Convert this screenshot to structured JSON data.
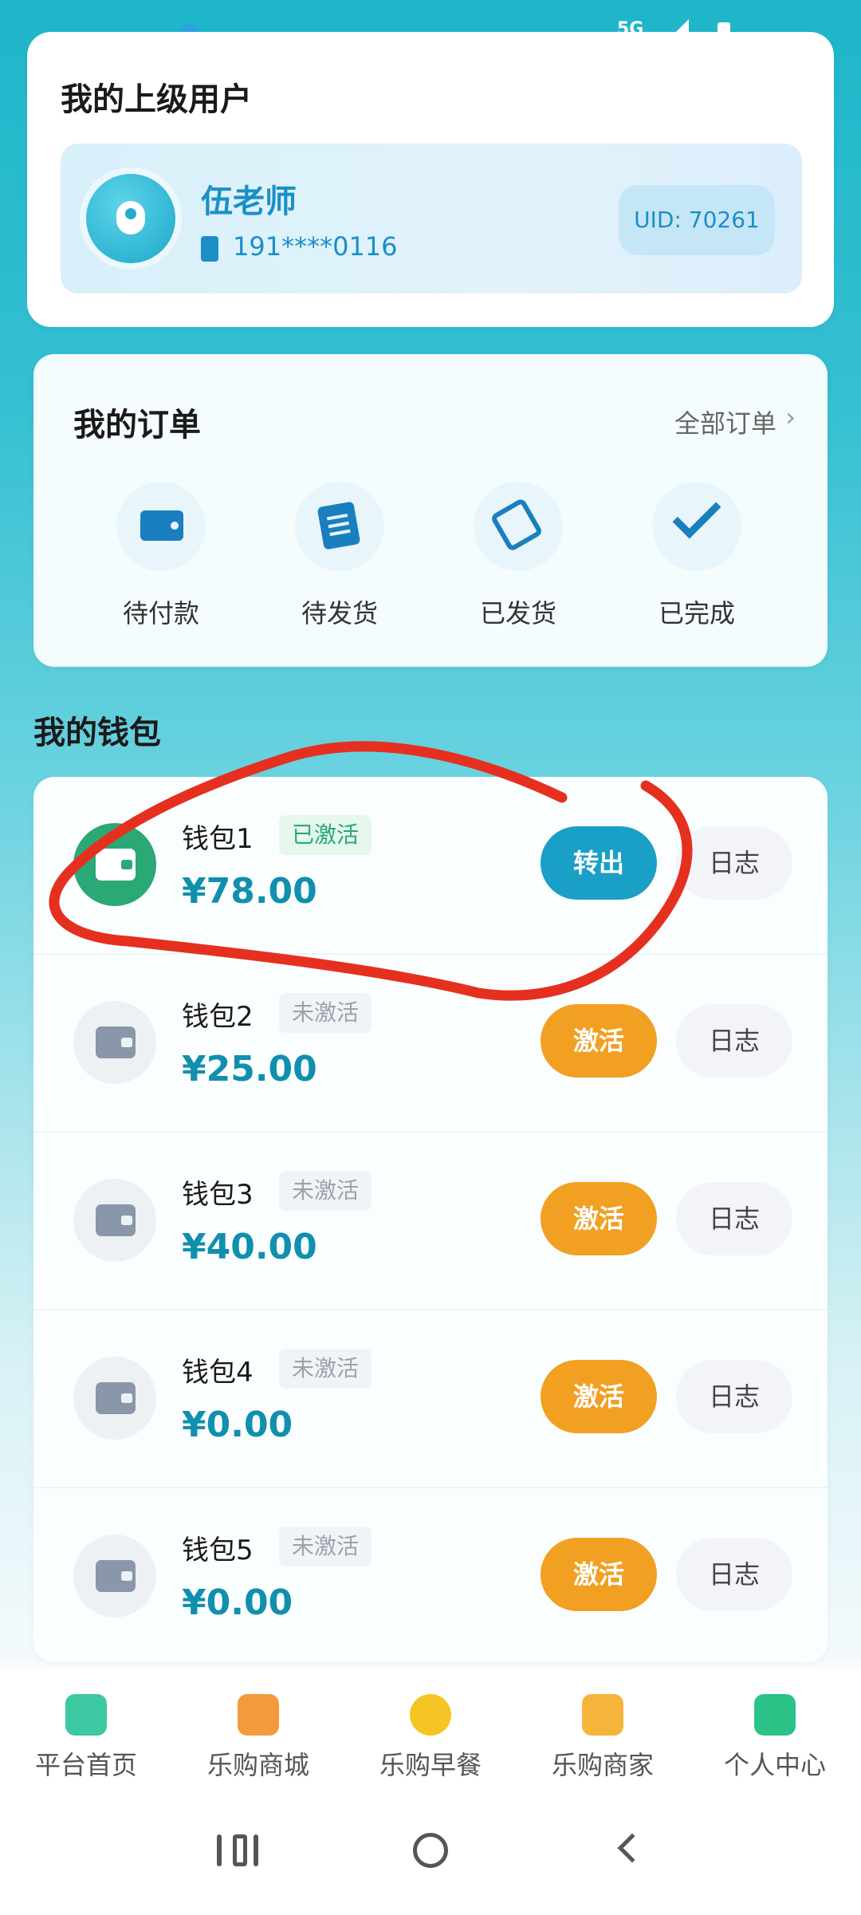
{
  "superior": {
    "title": "我的上级用户",
    "name": "伍老师",
    "phone": "191****0116",
    "uid": "UID: 70261"
  },
  "orders": {
    "title": "我的订单",
    "all_label": "全部订单",
    "items": [
      {
        "label": "待付款",
        "icon": "wallet-icon"
      },
      {
        "label": "待发货",
        "icon": "clipboard-icon"
      },
      {
        "label": "已发货",
        "icon": "ticket-icon"
      },
      {
        "label": "已完成",
        "icon": "check-icon"
      }
    ]
  },
  "wallet": {
    "title": "我的钱包",
    "items": [
      {
        "name": "钱包1",
        "status": "已激活",
        "balance": "¥78.00",
        "action": "转出",
        "log": "日志",
        "active": true
      },
      {
        "name": "钱包2",
        "status": "未激活",
        "balance": "¥25.00",
        "action": "激活",
        "log": "日志",
        "active": false
      },
      {
        "name": "钱包3",
        "status": "未激活",
        "balance": "¥40.00",
        "action": "激活",
        "log": "日志",
        "active": false
      },
      {
        "name": "钱包4",
        "status": "未激活",
        "balance": "¥0.00",
        "action": "激活",
        "log": "日志",
        "active": false
      },
      {
        "name": "钱包5",
        "status": "未激活",
        "balance": "¥0.00",
        "action": "激活",
        "log": "日志",
        "active": false
      }
    ]
  },
  "tabbar": {
    "items": [
      {
        "label": "平台首页",
        "icon": "home-icon",
        "color": "#3cc8a0"
      },
      {
        "label": "乐购商城",
        "icon": "mall-icon",
        "color": "#f39a3c"
      },
      {
        "label": "乐购早餐",
        "icon": "breakfast-icon",
        "color": "#f5c425"
      },
      {
        "label": "乐购商家",
        "icon": "merchant-icon",
        "color": "#f5b43a"
      },
      {
        "label": "个人中心",
        "icon": "profile-icon",
        "color": "#2cc287"
      }
    ]
  },
  "status_bar": {
    "network": "5G"
  },
  "colors": {
    "accent": "#1a9fc7",
    "activate": "#f1a022",
    "active_green": "#2aa876",
    "annotation_red": "#e53020"
  }
}
